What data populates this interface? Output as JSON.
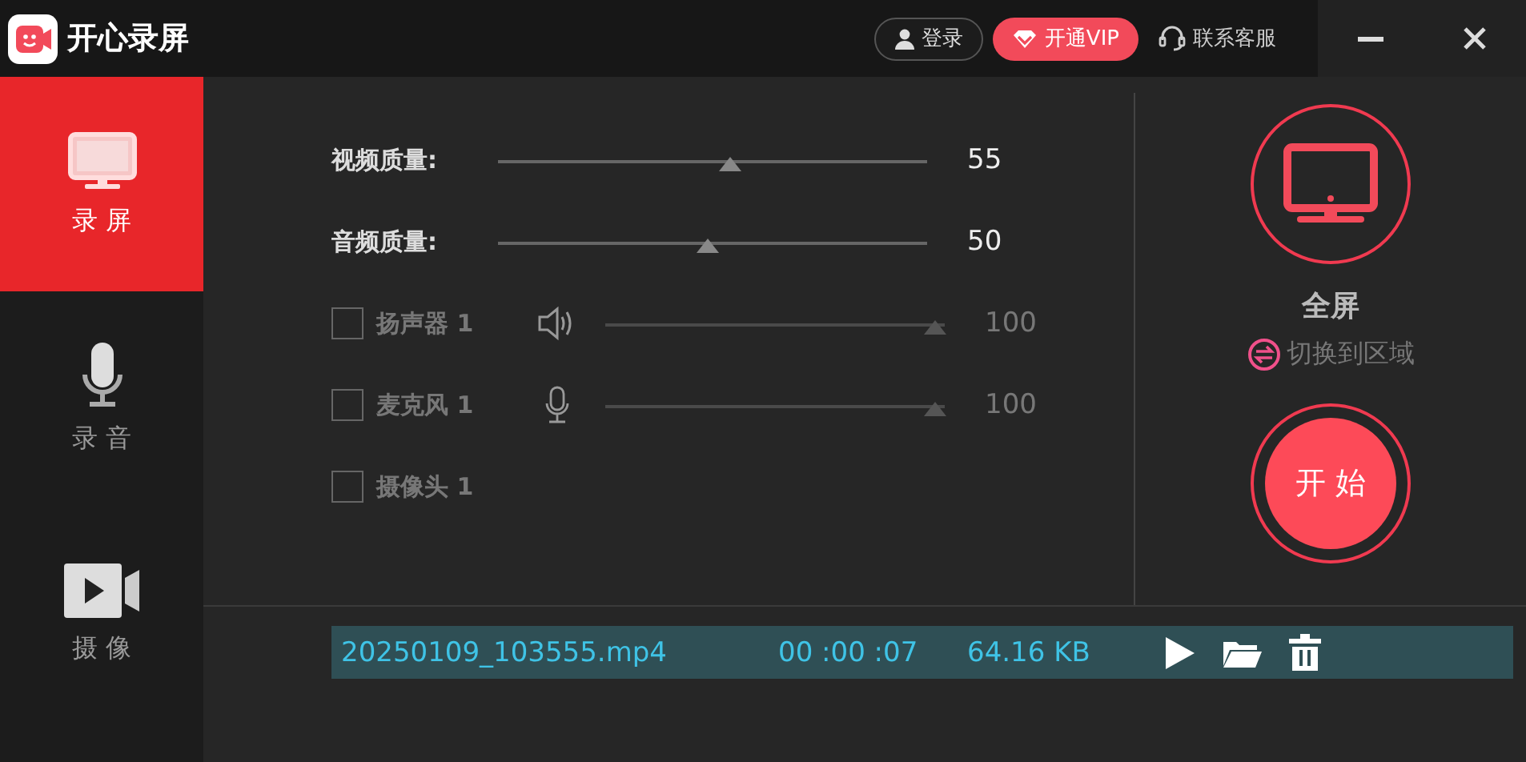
{
  "app": {
    "title": "开心录屏"
  },
  "header_buttons": [
    {
      "kind": "login",
      "label": "登录"
    },
    {
      "kind": "vip",
      "label": "开通VIP"
    },
    {
      "kind": "support",
      "label": "联系客服"
    }
  ],
  "sidebar": {
    "items": [
      {
        "kind": "screen",
        "label": "录 屏",
        "selected": true
      },
      {
        "kind": "audio",
        "label": "录 音",
        "selected": false
      },
      {
        "kind": "camera",
        "label": "摄 像",
        "selected": false
      }
    ]
  },
  "settings": [
    {
      "kind": "slider",
      "label": "视频质量:",
      "level": 0.54,
      "value": "55"
    },
    {
      "kind": "slider",
      "label": "音频质量:",
      "level": 0.49,
      "value": "50"
    },
    {
      "kind": "speaker",
      "label": "扬声器 1",
      "checked": false,
      "level": 0.97,
      "value": "100"
    },
    {
      "kind": "mic",
      "label": "麦克风 1",
      "checked": false,
      "level": 0.97,
      "value": "100"
    },
    {
      "kind": "camera",
      "label": "摄像头 1",
      "checked": false
    }
  ],
  "mode": {
    "title": "全屏",
    "switch_label": "切换到区域",
    "start_label": "开 始"
  },
  "recordings": [
    {
      "file": "20250109_103555.mp4",
      "duration": "00 :00 :07",
      "size": "64.16 KB"
    }
  ]
}
